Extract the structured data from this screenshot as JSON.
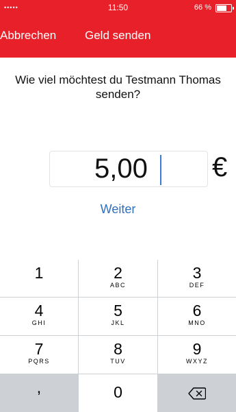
{
  "status_bar": {
    "signal": "•••••",
    "time": "11:50",
    "battery": "66 %"
  },
  "nav": {
    "cancel": "Abbrechen",
    "title": "Geld senden"
  },
  "question": "Wie viel möchtest du Testmann Thomas senden?",
  "amount": {
    "value": "5,00",
    "currency": "€"
  },
  "next_label": "Weiter",
  "keypad": {
    "keys": [
      {
        "digit": "1",
        "letters": ""
      },
      {
        "digit": "2",
        "letters": "ABC"
      },
      {
        "digit": "3",
        "letters": "DEF"
      },
      {
        "digit": "4",
        "letters": "GHI"
      },
      {
        "digit": "5",
        "letters": "JKL"
      },
      {
        "digit": "6",
        "letters": "MNO"
      },
      {
        "digit": "7",
        "letters": "PQRS"
      },
      {
        "digit": "8",
        "letters": "TUV"
      },
      {
        "digit": "9",
        "letters": "WXYZ"
      },
      {
        "digit": ",",
        "letters": ""
      },
      {
        "digit": "0",
        "letters": ""
      }
    ],
    "delete_icon": "backspace-icon"
  },
  "colors": {
    "header": "#e8202a",
    "link": "#2f6fbe",
    "keypad_bg": "#cdd1d6"
  }
}
